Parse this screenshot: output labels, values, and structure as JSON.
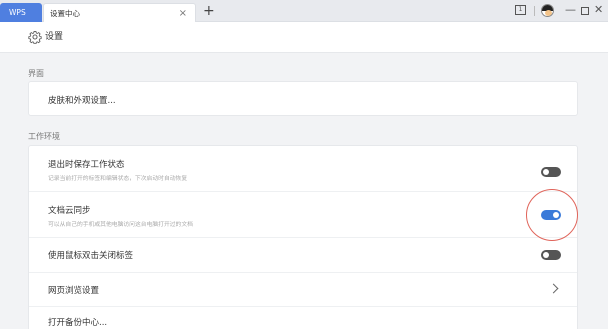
{
  "tabs": {
    "wps_label": "WPS",
    "active_label": "设置中心",
    "close_glyph": "×",
    "new_glyph": "+"
  },
  "window_controls": {
    "minimize_glyph": "—",
    "close_glyph": "✕",
    "box_icon_text": "1"
  },
  "header": {
    "title": "设置",
    "icon": "gear-icon"
  },
  "sections": {
    "interface": {
      "label": "界面",
      "rows": [
        {
          "title": "皮肤和外观设置..."
        }
      ]
    },
    "workspace": {
      "label": "工作环境",
      "rows": [
        {
          "title": "退出时保存工作状态",
          "desc": "记录当前打开的标签和编辑状态，下次启动时自动恢复",
          "toggle": "off"
        },
        {
          "title": "文档云同步",
          "desc": "可以从自己的手机或其他电脑访问这台电脑打开过的文档",
          "toggle": "on"
        },
        {
          "title": "使用鼠标双击关闭标签",
          "toggle": "off"
        },
        {
          "title": "网页浏览设置",
          "icon": "chevron-right-icon"
        },
        {
          "title": "打开备份中心..."
        }
      ]
    }
  },
  "colors": {
    "accent": "#3a7ad9",
    "wps_tab": "#4f7fe0",
    "highlight": "#e0645a"
  }
}
